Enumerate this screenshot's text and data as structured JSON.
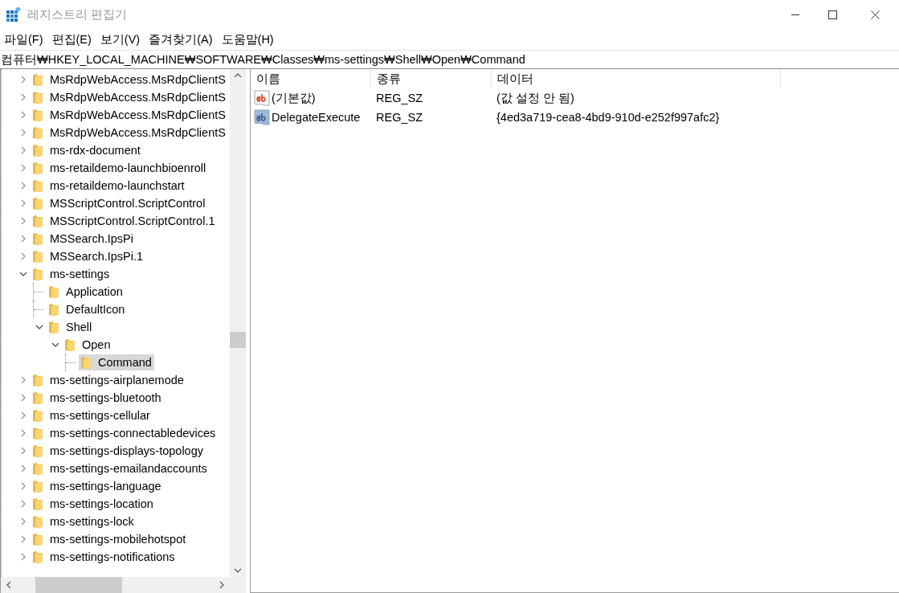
{
  "window": {
    "title": "레지스트리 편집기"
  },
  "menu": [
    {
      "label": "파일(F)"
    },
    {
      "label": "편집(E)"
    },
    {
      "label": "보기(V)"
    },
    {
      "label": "즐겨찾기(A)"
    },
    {
      "label": "도움말(H)"
    }
  ],
  "address": {
    "value": "컴퓨터₩HKEY_LOCAL_MACHINE₩SOFTWARE₩Classes₩ms-settings₩Shell₩Open₩Command"
  },
  "tree": {
    "items": [
      {
        "label": "MsRdpWebAccess.MsRdpClientS",
        "kind": "branch",
        "expanded": false,
        "selected": false
      },
      {
        "label": "MsRdpWebAccess.MsRdpClientS",
        "kind": "branch",
        "expanded": false,
        "selected": false
      },
      {
        "label": "MsRdpWebAccess.MsRdpClientS",
        "kind": "branch",
        "expanded": false,
        "selected": false
      },
      {
        "label": "MsRdpWebAccess.MsRdpClientS",
        "kind": "branch",
        "expanded": false,
        "selected": false
      },
      {
        "label": "ms-rdx-document",
        "kind": "branch",
        "expanded": false,
        "selected": false
      },
      {
        "label": "ms-retaildemo-launchbioenroll",
        "kind": "branch",
        "expanded": false,
        "selected": false
      },
      {
        "label": "ms-retaildemo-launchstart",
        "kind": "branch",
        "expanded": false,
        "selected": false
      },
      {
        "label": "MSScriptControl.ScriptControl",
        "kind": "branch",
        "expanded": false,
        "selected": false
      },
      {
        "label": "MSScriptControl.ScriptControl.1",
        "kind": "branch",
        "expanded": false,
        "selected": false
      },
      {
        "label": "MSSearch.IpsPi",
        "kind": "branch",
        "expanded": false,
        "selected": false
      },
      {
        "label": "MSSearch.IpsPi.1",
        "kind": "branch",
        "expanded": false,
        "selected": false
      },
      {
        "label": "ms-settings",
        "kind": "branch",
        "expanded": true,
        "selected": false,
        "children": [
          {
            "label": "Application",
            "kind": "leaf",
            "selected": false
          },
          {
            "label": "DefaultIcon",
            "kind": "leaf",
            "selected": false
          },
          {
            "label": "Shell",
            "kind": "branch",
            "expanded": true,
            "selected": false,
            "children": [
              {
                "label": "Open",
                "kind": "branch",
                "expanded": true,
                "selected": false,
                "children": [
                  {
                    "label": "Command",
                    "kind": "leaf",
                    "selected": true
                  }
                ]
              }
            ]
          }
        ]
      },
      {
        "label": "ms-settings-airplanemode",
        "kind": "branch",
        "expanded": false,
        "selected": false
      },
      {
        "label": "ms-settings-bluetooth",
        "kind": "branch",
        "expanded": false,
        "selected": false
      },
      {
        "label": "ms-settings-cellular",
        "kind": "branch",
        "expanded": false,
        "selected": false
      },
      {
        "label": "ms-settings-connectabledevices",
        "kind": "branch",
        "expanded": false,
        "selected": false
      },
      {
        "label": "ms-settings-displays-topology",
        "kind": "branch",
        "expanded": false,
        "selected": false
      },
      {
        "label": "ms-settings-emailandaccounts",
        "kind": "branch",
        "expanded": false,
        "selected": false
      },
      {
        "label": "ms-settings-language",
        "kind": "branch",
        "expanded": false,
        "selected": false
      },
      {
        "label": "ms-settings-location",
        "kind": "branch",
        "expanded": false,
        "selected": false
      },
      {
        "label": "ms-settings-lock",
        "kind": "branch",
        "expanded": false,
        "selected": false
      },
      {
        "label": "ms-settings-mobilehotspot",
        "kind": "branch",
        "expanded": false,
        "selected": false
      },
      {
        "label": "ms-settings-notifications",
        "kind": "branch",
        "expanded": false,
        "selected": false
      }
    ]
  },
  "values": {
    "columns": [
      "이름",
      "종류",
      "데이터"
    ],
    "rows": [
      {
        "name": "(기본값)",
        "type": "REG_SZ",
        "data": "(값 설정 안 됨)",
        "selected": false
      },
      {
        "name": "DelegateExecute",
        "type": "REG_SZ",
        "data": "{4ed3a719-cea8-4bd9-910d-e252f997afc2}",
        "selected": true
      }
    ]
  }
}
